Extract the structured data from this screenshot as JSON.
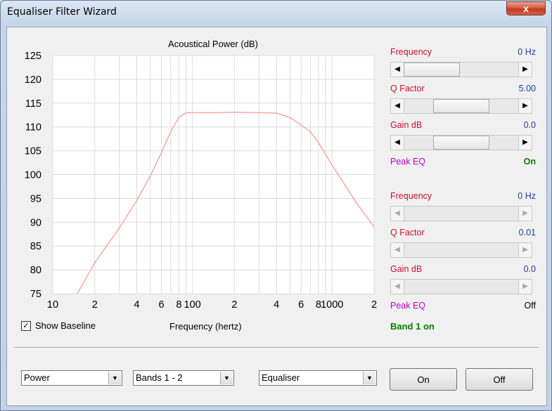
{
  "window": {
    "title": "Equaliser Filter Wizard",
    "close_symbol": "x"
  },
  "chart_data": {
    "type": "line",
    "title": "Acoustical Power (dB)",
    "xlabel": "Frequency (hertz)",
    "ylabel": "",
    "xscale": "log",
    "xlim": [
      10,
      2000
    ],
    "ylim": [
      75,
      125
    ],
    "yticks": [
      75,
      80,
      85,
      90,
      95,
      100,
      105,
      110,
      115,
      120,
      125
    ],
    "xtick_labels": [
      {
        "value": 10,
        "label": "10"
      },
      {
        "value": 20,
        "label": "2"
      },
      {
        "value": 40,
        "label": "4"
      },
      {
        "value": 60,
        "label": "6"
      },
      {
        "value": 80,
        "label": "8"
      },
      {
        "value": 100,
        "label": "100"
      },
      {
        "value": 200,
        "label": "2"
      },
      {
        "value": 400,
        "label": "4"
      },
      {
        "value": 600,
        "label": "6"
      },
      {
        "value": 800,
        "label": "8"
      },
      {
        "value": 1000,
        "label": "1000"
      },
      {
        "value": 2000,
        "label": "2"
      }
    ],
    "grid": true,
    "series": [
      {
        "color": "#f4a9a3",
        "x": [
          15,
          20,
          30,
          40,
          50,
          60,
          70,
          80,
          90,
          100,
          150,
          200,
          300,
          400,
          500,
          600,
          700,
          800,
          1000,
          1500,
          2000
        ],
        "y": [
          75.0,
          81.5,
          88.8,
          94.6,
          99.7,
          104.6,
          109.0,
          112.0,
          113.0,
          113.0,
          113.0,
          113.1,
          113.0,
          112.9,
          112.0,
          110.4,
          109.0,
          106.7,
          102.0,
          94.0,
          89.0
        ]
      }
    ]
  },
  "baseline": {
    "checked": true,
    "check_mark": "✓",
    "label": "Show Baseline"
  },
  "band1": {
    "frequency_label": "Frequency",
    "frequency_value": "0 Hz",
    "q_label": "Q Factor",
    "q_value": "5.00",
    "gain_label": "Gain  dB",
    "gain_value": "0.0",
    "peak_label": "Peak EQ",
    "peak_value": "On"
  },
  "band2": {
    "frequency_label": "Frequency",
    "frequency_value": "0 Hz",
    "q_label": "Q Factor",
    "q_value": "0.01",
    "gain_label": "Gain  dB",
    "gain_value": "0.0",
    "peak_label": "Peak EQ",
    "peak_value": "Off"
  },
  "band_status": "Band 1 on",
  "sliders": {
    "band1_frequency": 0.0,
    "band1_q": 0.5,
    "band1_gain": 0.5
  },
  "arrows": {
    "left": "◀",
    "right": "▶"
  },
  "combos": {
    "mode": "Power",
    "bands": "Bands 1 - 2",
    "filter": "Equaliser",
    "arrow": "▼"
  },
  "buttons": {
    "on": "On",
    "off": "Off"
  }
}
